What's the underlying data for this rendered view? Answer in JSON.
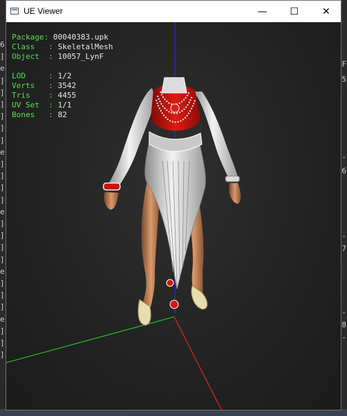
{
  "window": {
    "title": "UE Viewer",
    "buttons": {
      "minimize": "—",
      "maximize": "☐",
      "close": "✕"
    }
  },
  "info": {
    "package": {
      "label": "Package: ",
      "value": "00040383.upk"
    },
    "class": {
      "label": "Class   : ",
      "value": "SkeletalMesh"
    },
    "object": {
      "label": "Object  : ",
      "value": "10057_LynF"
    },
    "lod": {
      "label": "LOD     : ",
      "value": "1/2"
    },
    "verts": {
      "label": "Verts   : ",
      "value": "3542"
    },
    "tris": {
      "label": "Tris    : ",
      "value": "4455"
    },
    "uvset": {
      "label": "UV Set  : ",
      "value": "1/1"
    },
    "bones": {
      "label": "Bones   : ",
      "value": "82"
    }
  },
  "colors": {
    "label_green": "#4fe24f",
    "axis_x": "#ff2a2a",
    "axis_y": "#25d825",
    "axis_z": "#2a2aff",
    "dress_red": "#c8140e",
    "dress_white": "#e6e6e6"
  },
  "background": {
    "left_glyphs": [
      "6",
      "]",
      "e",
      "]",
      "]",
      "]",
      "]",
      "]",
      "]",
      "e",
      "]",
      "]",
      "]",
      "]",
      "e",
      "]",
      "]",
      "]",
      "]",
      "e",
      "]",
      "]",
      "]",
      "e",
      "]",
      "]",
      "]"
    ],
    "right_glyphs": [
      "F",
      "5",
      "-",
      "6",
      "-",
      "7",
      "-",
      "8",
      "-"
    ]
  }
}
